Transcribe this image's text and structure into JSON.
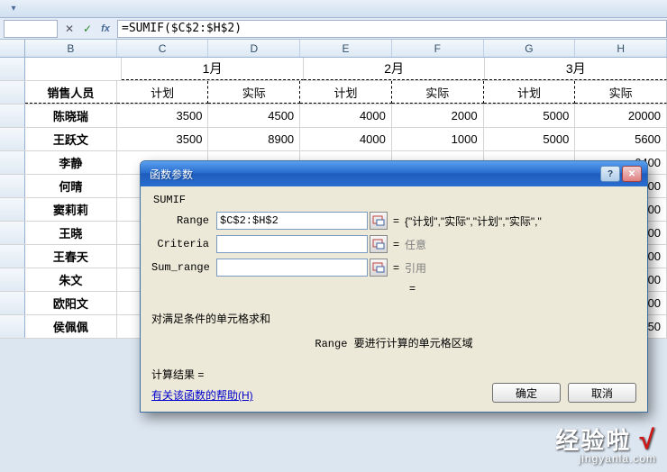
{
  "formula_bar": {
    "value": "=SUMIF($C$2:$H$2)"
  },
  "columns": [
    "B",
    "C",
    "D",
    "E",
    "F",
    "G",
    "H"
  ],
  "header": {
    "sales_person": "销售人员",
    "months": [
      "1月",
      "2月",
      "3月"
    ],
    "sub": {
      "plan": "计划",
      "actual": "实际"
    }
  },
  "rows": [
    {
      "name": "陈晓瑞",
      "v": [
        "3500",
        "4500",
        "4000",
        "2000",
        "5000",
        "20000"
      ]
    },
    {
      "name": "王跃文",
      "v": [
        "3500",
        "8900",
        "4000",
        "1000",
        "5000",
        "5600"
      ]
    },
    {
      "name": "李静",
      "v": [
        "",
        "",
        "",
        "",
        "",
        "6400"
      ]
    },
    {
      "name": "何晴",
      "v": [
        "",
        "",
        "",
        "",
        "",
        "5000"
      ]
    },
    {
      "name": "窦莉莉",
      "v": [
        "",
        "",
        "",
        "",
        "",
        "3000"
      ]
    },
    {
      "name": "王晓",
      "v": [
        "",
        "",
        "",
        "",
        "",
        "3500"
      ]
    },
    {
      "name": "王春天",
      "v": [
        "",
        "",
        "",
        "",
        "",
        "5600"
      ]
    },
    {
      "name": "朱文",
      "v": [
        "",
        "",
        "",
        "",
        "",
        "8000"
      ]
    },
    {
      "name": "欧阳文",
      "v": [
        "",
        "",
        "",
        "",
        "",
        "9000"
      ]
    },
    {
      "name": "侯佩佩",
      "v": [
        "",
        "",
        "",
        "",
        "",
        "7650"
      ]
    }
  ],
  "dialog": {
    "title": "函数参数",
    "fn": "SUMIF",
    "params": {
      "range_label": "Range",
      "range_value": "$C$2:$H$2",
      "range_result": "{\"计划\",\"实际\",\"计划\",\"实际\",\"",
      "criteria_label": "Criteria",
      "criteria_value": "",
      "criteria_result": "任意",
      "sum_label": "Sum_range",
      "sum_value": "",
      "sum_result": "引用"
    },
    "eq": "=",
    "desc": "对满足条件的单元格求和",
    "param_help": "Range 要进行计算的单元格区域",
    "calc_label": "计算结果 =",
    "help_link": "有关该函数的帮助(H)",
    "ok": "确定",
    "cancel": "取消"
  },
  "watermark": {
    "main": "经验啦",
    "check": "√",
    "sub": "jingyanla.com"
  }
}
